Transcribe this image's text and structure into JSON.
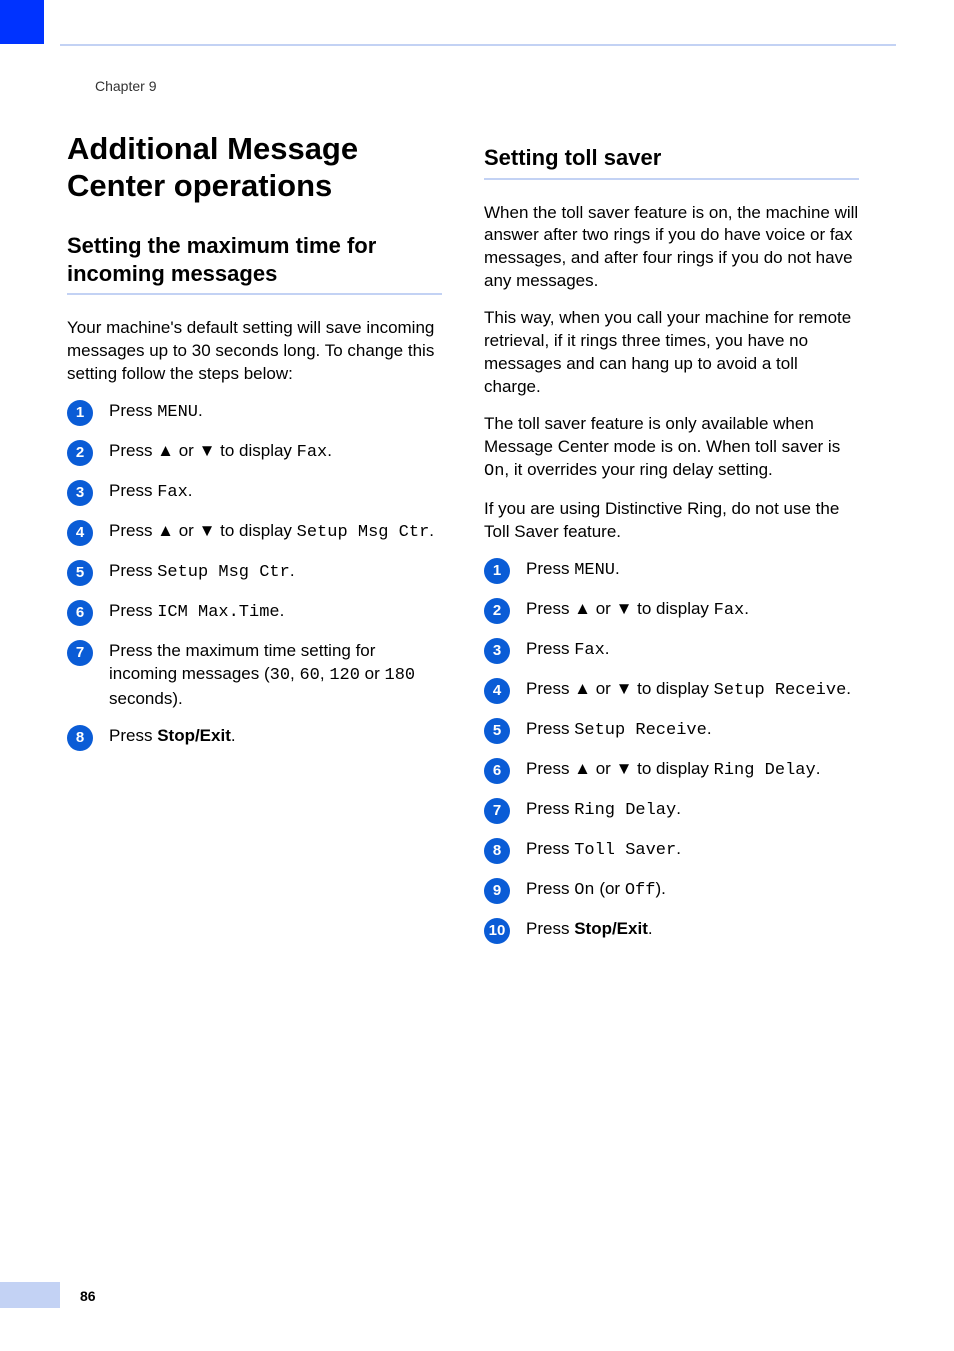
{
  "chapter": "Chapter 9",
  "page_number": "86",
  "left_col": {
    "main_title": "Additional Message Center operations",
    "sub_title": "Setting the maximum time for incoming messages",
    "intro": "Your machine's default setting will save incoming messages up to 30 seconds long. To change this setting follow the steps below:",
    "steps": [
      {
        "n": "1",
        "pre": "Press ",
        "mono1": "MENU",
        "post1": "."
      },
      {
        "n": "2",
        "pre": "Press ▲ or ▼ to display ",
        "mono1": "Fax",
        "post1": "."
      },
      {
        "n": "3",
        "pre": "Press ",
        "mono1": "Fax",
        "post1": "."
      },
      {
        "n": "4",
        "pre": "Press ▲ or ▼ to display ",
        "mono1": "Setup Msg Ctr",
        "post1": "."
      },
      {
        "n": "5",
        "pre": "Press ",
        "mono1": "Setup Msg Ctr",
        "post1": "."
      },
      {
        "n": "6",
        "pre": "Press ",
        "mono1": "ICM Max.Time",
        "post1": "."
      },
      {
        "n": "7",
        "pre": "Press the maximum time setting for incoming messages (",
        "mono1": "30",
        "mid1": ", ",
        "mono2": "60",
        "mid2": ", ",
        "mono3": "120",
        "mid3": " or ",
        "mono4": "180",
        "post1": " seconds)."
      },
      {
        "n": "8",
        "pre": "Press ",
        "bold1": "Stop/Exit",
        "post1": "."
      }
    ]
  },
  "right_col": {
    "sub_title": "Setting toll saver",
    "paras": [
      "When the toll saver feature is on, the machine will answer after two rings if you do have voice or fax messages, and after four rings if you do not have any messages.",
      "This way, when you call your machine for remote retrieval, if it rings three times, you have no messages and can hang up to avoid a toll charge."
    ],
    "para3_pre": "The toll saver feature is only available when Message Center mode is on. When toll saver is ",
    "para3_mono": "On",
    "para3_post": ", it overrides your ring delay setting.",
    "para4": "If you are using Distinctive Ring, do not use the Toll Saver feature.",
    "steps": [
      {
        "n": "1",
        "pre": "Press ",
        "mono1": "MENU",
        "post1": "."
      },
      {
        "n": "2",
        "pre": "Press ▲ or ▼ to display ",
        "mono1": "Fax",
        "post1": "."
      },
      {
        "n": "3",
        "pre": "Press ",
        "mono1": "Fax",
        "post1": "."
      },
      {
        "n": "4",
        "pre": "Press ▲ or ▼ to display ",
        "mono1": "Setup Receive",
        "post1": "."
      },
      {
        "n": "5",
        "pre": "Press ",
        "mono1": "Setup Receive",
        "post1": "."
      },
      {
        "n": "6",
        "pre": "Press ▲ or ▼ to display ",
        "mono1": "Ring Delay",
        "post1": "."
      },
      {
        "n": "7",
        "pre": "Press ",
        "mono1": "Ring Delay",
        "post1": "."
      },
      {
        "n": "8",
        "pre": "Press ",
        "mono1": "Toll Saver",
        "post1": "."
      },
      {
        "n": "9",
        "pre": "Press ",
        "mono1": "On",
        "mid1": " (or ",
        "mono2": "Off",
        "post1": ")."
      },
      {
        "n": "10",
        "pre": "Press ",
        "bold1": "Stop/Exit",
        "post1": "."
      }
    ]
  }
}
